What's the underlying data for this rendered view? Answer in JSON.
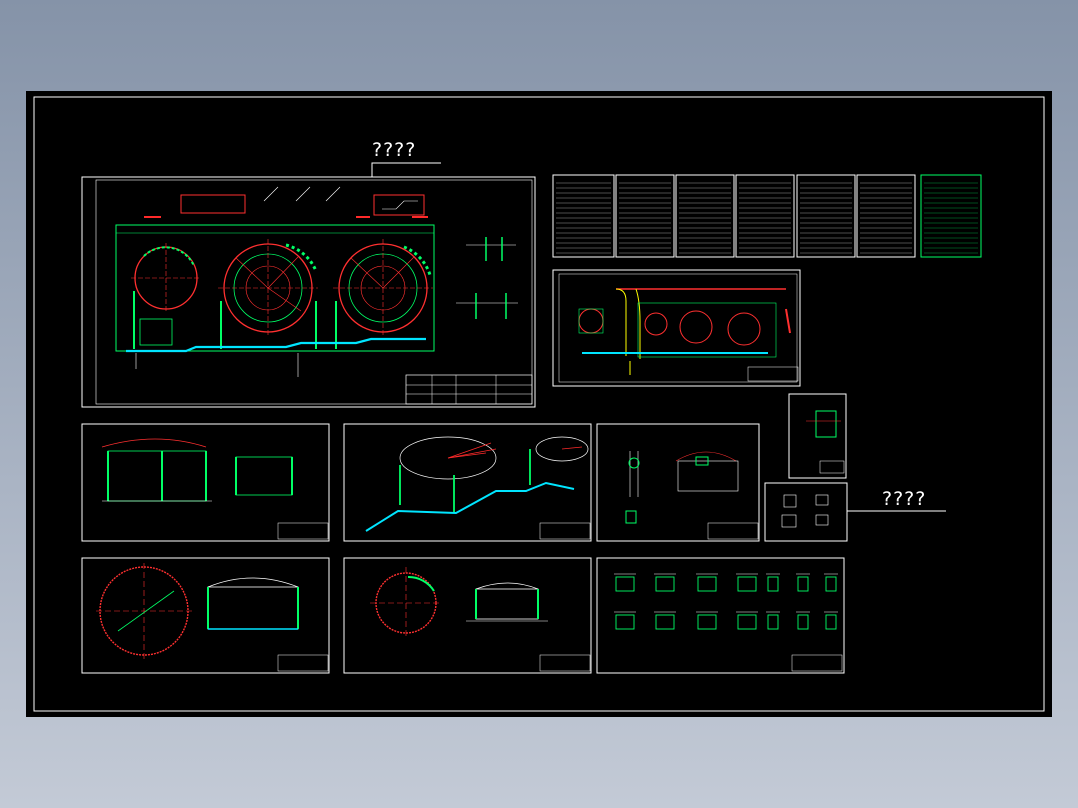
{
  "callouts": {
    "top_label": "????",
    "right_label": "????"
  },
  "colors": {
    "background": "#000000",
    "frame": "#ffffff",
    "tank_outline": "#ff3030",
    "steel_green": "#00ff66",
    "pipe_cyan": "#00e5ff",
    "dimension_red": "#ff2a2a",
    "note_yellow": "#ffff00"
  }
}
